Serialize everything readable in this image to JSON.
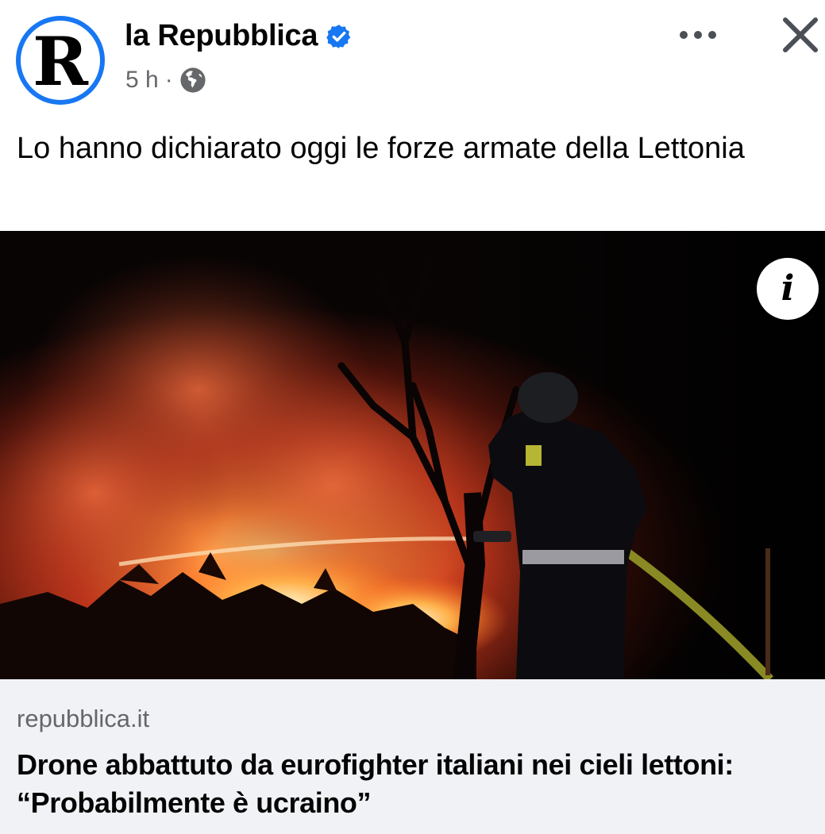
{
  "header": {
    "avatar_letter": "R",
    "page_name": "la Repubblica",
    "timestamp": "5 h",
    "separator": "·",
    "verified_icon": "verified-badge-icon",
    "audience_icon": "globe-icon"
  },
  "post": {
    "text": "Lo hanno dichiarato oggi le forze armate della Lettonia"
  },
  "image": {
    "info_glyph": "i",
    "description_icon": "info-icon"
  },
  "link_preview": {
    "domain": "repubblica.it",
    "title": "Drone abbattuto da eurofighter italiani nei cieli lettoni: “Probabilmente è ucraino”"
  },
  "colors": {
    "accent": "#1877f2",
    "secondary_text": "#65676b",
    "link_background": "#f0f2f5"
  }
}
